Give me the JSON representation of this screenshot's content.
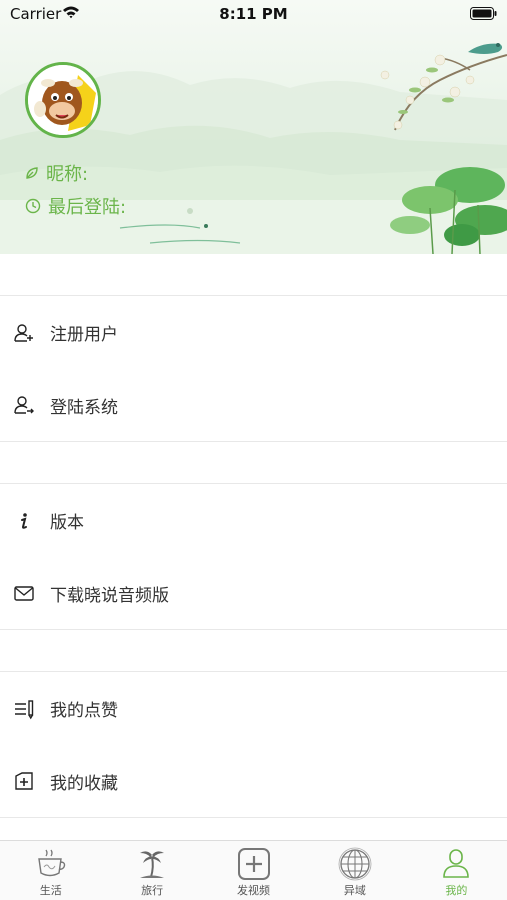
{
  "status_bar": {
    "carrier": "Carrier",
    "time": "8:11 PM"
  },
  "profile": {
    "nickname_label": "昵称:",
    "last_login_label": "最后登陆:"
  },
  "menu_groups": [
    {
      "items": [
        {
          "label": "注册用户",
          "icon": "add-user-icon"
        },
        {
          "label": "登陆系统",
          "icon": "login-user-icon"
        }
      ]
    },
    {
      "items": [
        {
          "label": "版本",
          "icon": "info-icon"
        },
        {
          "label": "下载晓说音频版",
          "icon": "mail-icon"
        }
      ]
    },
    {
      "items": [
        {
          "label": "我的点赞",
          "icon": "list-pen-icon"
        },
        {
          "label": "我的收藏",
          "icon": "add-folder-icon"
        }
      ]
    }
  ],
  "tabbar": {
    "tabs": [
      {
        "label": "生活",
        "icon": "coffee-cup-icon"
      },
      {
        "label": "旅行",
        "icon": "palm-tree-icon"
      },
      {
        "label": "发视频",
        "icon": "plus-square-icon"
      },
      {
        "label": "异域",
        "icon": "globe-icon"
      },
      {
        "label": "我的",
        "icon": "person-icon"
      }
    ],
    "active_index": 4,
    "active_color": "#6bb54a"
  },
  "colors": {
    "accent": "#6bb54a",
    "avatar_border": "#63b44a"
  }
}
